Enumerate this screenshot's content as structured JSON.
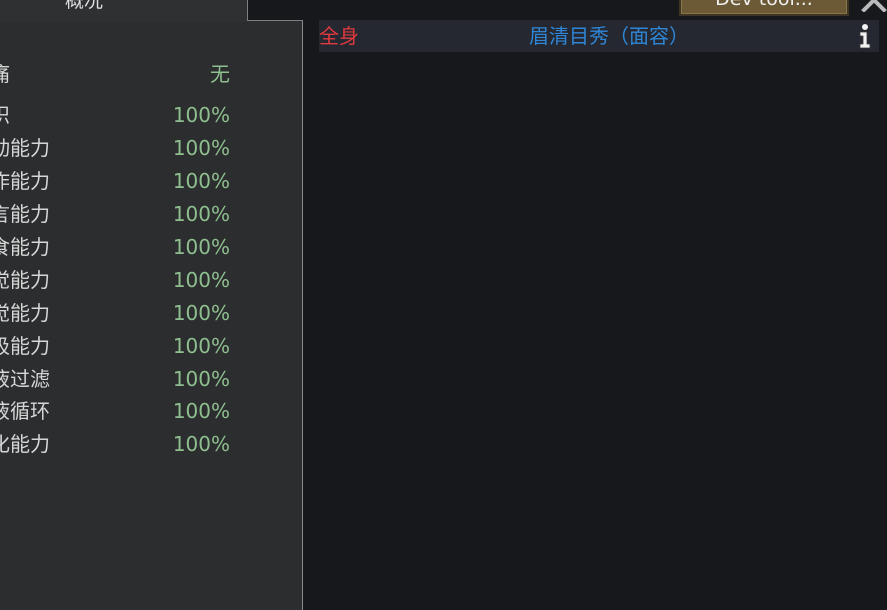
{
  "overview": {
    "tab_label": "概况",
    "pain": {
      "label": "疼痛",
      "value": "无"
    },
    "capacities": [
      {
        "label": "意识",
        "value": "100%"
      },
      {
        "label": "移动能力",
        "value": "100%"
      },
      {
        "label": "操作能力",
        "value": "100%"
      },
      {
        "label": "语言能力",
        "value": "100%"
      },
      {
        "label": "进食能力",
        "value": "100%"
      },
      {
        "label": "视觉能力",
        "value": "100%"
      },
      {
        "label": "听觉能力",
        "value": "100%"
      },
      {
        "label": "呼吸能力",
        "value": "100%"
      },
      {
        "label": "血液过滤",
        "value": "100%"
      },
      {
        "label": "血液循环",
        "value": "100%"
      },
      {
        "label": "消化能力",
        "value": "100%"
      }
    ]
  },
  "toolbar": {
    "dev_tool_label": "Dev tool..."
  },
  "health_table": {
    "part": "全身",
    "condition": "眉清目秀（面容）"
  },
  "colors": {
    "value_green": "#8fbf8f",
    "part_red": "#e0393e",
    "condition_blue": "#2f86d6"
  }
}
